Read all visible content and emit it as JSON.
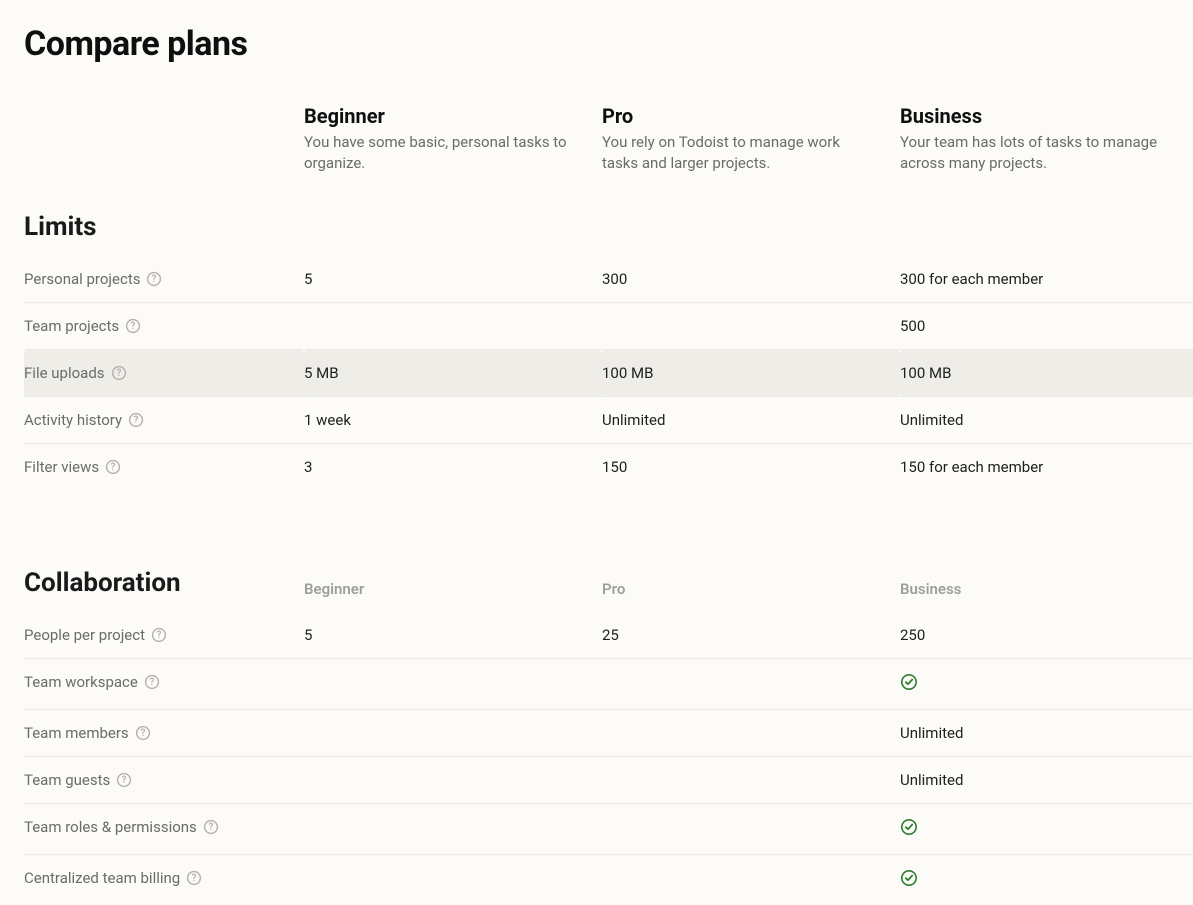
{
  "page_title": "Compare plans",
  "plans": [
    {
      "name": "Beginner",
      "desc": "You have some basic, personal tasks to organize."
    },
    {
      "name": "Pro",
      "desc": "You rely on Todoist to manage work tasks and larger projects."
    },
    {
      "name": "Business",
      "desc": "Your team has lots of tasks to manage across many projects."
    }
  ],
  "sections": {
    "limits": {
      "heading": "Limits",
      "rows": [
        {
          "label": "Personal projects",
          "beginner": "5",
          "pro": "300",
          "business": "300 for each member"
        },
        {
          "label": "Team projects",
          "beginner": "",
          "pro": "",
          "business": "500"
        },
        {
          "label": "File uploads",
          "beginner": "5 MB",
          "pro": "100 MB",
          "business": "100 MB",
          "hover": true
        },
        {
          "label": "Activity history",
          "beginner": "1 week",
          "pro": "Unlimited",
          "business": "Unlimited"
        },
        {
          "label": "Filter views",
          "beginner": "3",
          "pro": "150",
          "business": "150 for each member"
        }
      ]
    },
    "collaboration": {
      "heading": "Collaboration",
      "rows": [
        {
          "label": "People per project",
          "beginner": "5",
          "pro": "25",
          "business": "250"
        },
        {
          "label": "Team workspace",
          "beginner": "",
          "pro": "",
          "business": "__check__"
        },
        {
          "label": "Team members",
          "beginner": "",
          "pro": "",
          "business": "Unlimited"
        },
        {
          "label": "Team guests",
          "beginner": "",
          "pro": "",
          "business": "Unlimited"
        },
        {
          "label": "Team roles & permissions",
          "beginner": "",
          "pro": "",
          "business": "__check__"
        },
        {
          "label": "Centralized team billing",
          "beginner": "",
          "pro": "",
          "business": "__check__"
        }
      ]
    }
  }
}
